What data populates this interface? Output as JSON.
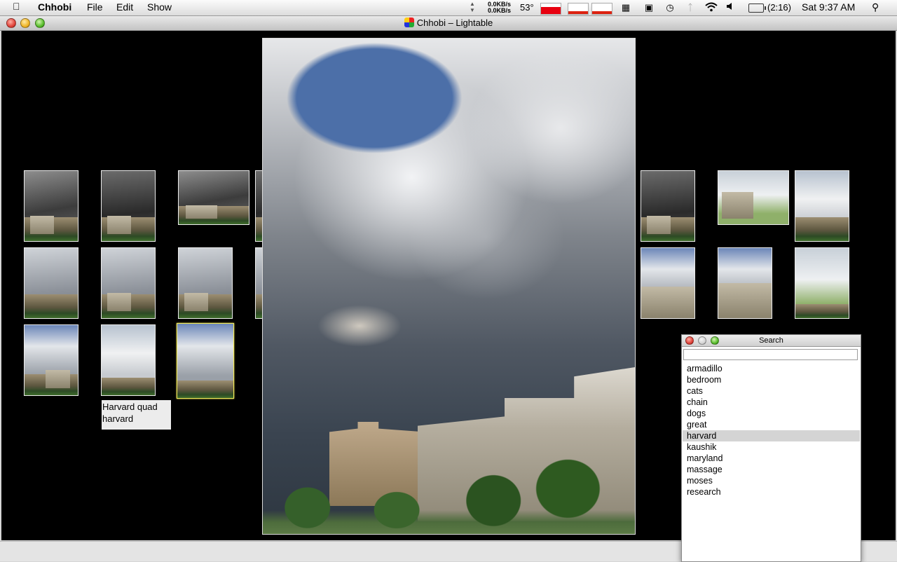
{
  "menubar": {
    "app_name": "Chhobi",
    "menus": [
      "File",
      "Edit",
      "Show"
    ],
    "network": {
      "arrows": "▲\n▼",
      "rates": "0.0KB/s\n0.0KB/s"
    },
    "temperature": "53°",
    "memory_fraction": 0.65,
    "battery_time": "(2:16)",
    "clock": "Sat 9:37 AM",
    "colors": {
      "memory_meter": "#e80010",
      "activity_graph": "#dd2211"
    },
    "icons": [
      "apple-logo-icon",
      "network-activity-icon",
      "memory-meter-icon",
      "cpu-meter-icon",
      "network-meter-icon",
      "script-menu-icon",
      "display-icon",
      "time-machine-icon",
      "bluetooth-icon",
      "wifi-icon",
      "volume-icon",
      "battery-icon",
      "spotlight-search-icon"
    ]
  },
  "window": {
    "title": "Chhobi – Lightable"
  },
  "lightable": {
    "tooltip": {
      "line1": "Harvard quad",
      "line2": "harvard"
    },
    "selected_thumbnail": 8,
    "colors": {
      "background": "#000000",
      "selection": "#f3ea5a"
    }
  },
  "search_panel": {
    "title": "Search",
    "query": "",
    "tags": [
      "armadillo",
      "bedroom",
      "cats",
      "chain",
      "dogs",
      "great",
      "harvard",
      "kaushik",
      "maryland",
      "massage",
      "moses",
      "research"
    ],
    "selected_tag": "harvard"
  }
}
